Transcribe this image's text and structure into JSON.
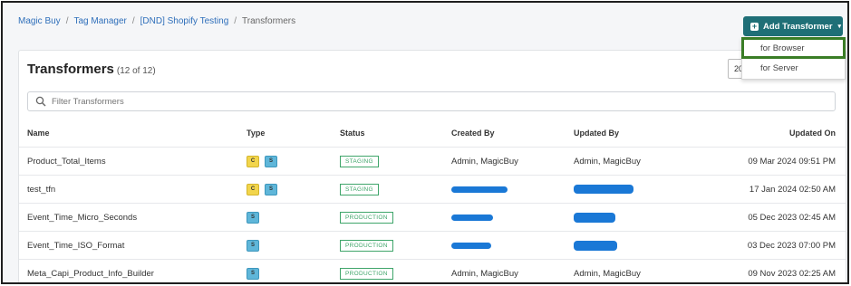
{
  "breadcrumb": {
    "items": [
      "Magic Buy",
      "Tag Manager",
      "[DND] Shopify Testing"
    ],
    "current": "Transformers",
    "separator": "/"
  },
  "add_button": {
    "label": "Add Transformer",
    "icon": "plus-square-icon",
    "caret": "▾"
  },
  "menu": {
    "items": [
      "for Browser",
      "for Server"
    ],
    "highlight_color": "#3a7d26"
  },
  "card": {
    "title": "Transformers",
    "count_text": "(12 of 12)",
    "page_size": "20"
  },
  "filter": {
    "placeholder": "Filter Transformers",
    "icon": "search-icon"
  },
  "table": {
    "columns": [
      "Name",
      "Type",
      "Status",
      "Created By",
      "Updated By",
      "Updated On"
    ],
    "rows": [
      {
        "name": "Product_Total_Items",
        "types": [
          "C",
          "S"
        ],
        "status": "STAGING",
        "created_by": "Admin, MagicBuy",
        "updated_by": "Admin, MagicBuy",
        "updated_on": "09 Mar 2024 09:51 PM"
      },
      {
        "name": "test_tfn",
        "types": [
          "C",
          "S"
        ],
        "status": "STAGING",
        "created_by": "",
        "updated_by": "",
        "updated_on": "17 Jan 2024 02:50 AM"
      },
      {
        "name": "Event_Time_Micro_Seconds",
        "types": [
          "S"
        ],
        "status": "PRODUCTION",
        "created_by": "",
        "updated_by": "",
        "updated_on": "05 Dec 2023 02:45 AM"
      },
      {
        "name": "Event_Time_ISO_Format",
        "types": [
          "S"
        ],
        "status": "PRODUCTION",
        "created_by": "",
        "updated_by": "",
        "updated_on": "03 Dec 2023 07:00 PM"
      },
      {
        "name": "Meta_Capi_Product_Info_Builder",
        "types": [
          "S"
        ],
        "status": "PRODUCTION",
        "created_by": "Admin, MagicBuy",
        "updated_by": "Admin, MagicBuy",
        "updated_on": "09 Nov 2023 02:25 AM"
      }
    ]
  },
  "colors": {
    "accent": "#1f6f77",
    "link": "#2f6fba",
    "status_green": "#3fa56a",
    "redaction": "#1a78d6"
  }
}
